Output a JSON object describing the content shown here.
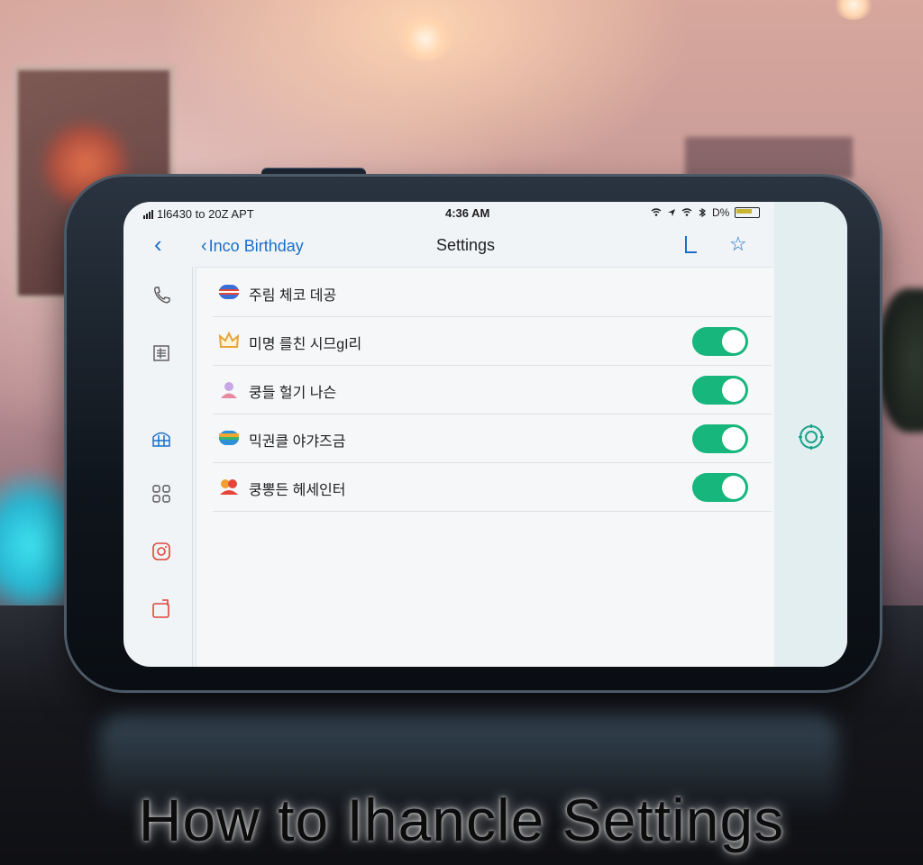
{
  "status_bar": {
    "left_text": "1l6430 to 20Z APT",
    "time": "4:36 AM",
    "right_text": "D%"
  },
  "nav": {
    "back_label": "Inco Birthday",
    "title": "Settings"
  },
  "settings": [
    {
      "label": "주림 체코 데공",
      "icon": "flag-icon",
      "has_toggle": false
    },
    {
      "label": "미명 를친 시므gI리",
      "icon": "crown-icon",
      "has_toggle": true,
      "toggle_on": true
    },
    {
      "label": "쿵들 헐기 나슨",
      "icon": "avatar-icon",
      "has_toggle": true,
      "toggle_on": true
    },
    {
      "label": "믹권클 야갸즈금",
      "icon": "rainbow-icon",
      "has_toggle": true,
      "toggle_on": true
    },
    {
      "label": "쿵뽕든 헤세인터",
      "icon": "people-icon",
      "has_toggle": true,
      "toggle_on": true
    }
  ],
  "sidebar_icons": [
    "phone-icon",
    "list-icon",
    "building-icon",
    "grid-icon",
    "camera-icon",
    "share-icon"
  ],
  "caption": "How to Ihancle Settings",
  "colors": {
    "accent": "#1b6fc9",
    "toggle_on": "#17b67c",
    "screen_bg": "#f1f4f7"
  }
}
